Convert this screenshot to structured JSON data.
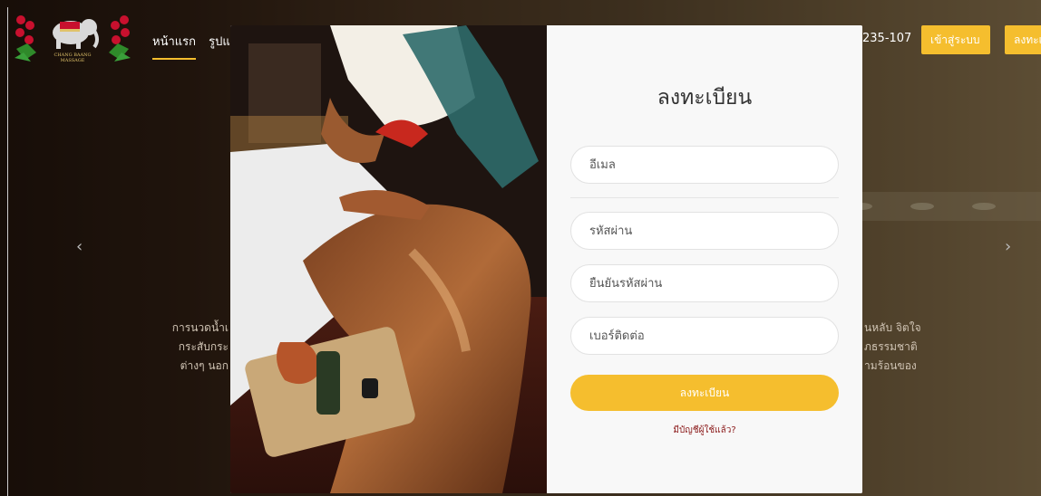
{
  "site": {
    "brand": "CHANG BAANG MASSAGE",
    "nav_items": [
      "หน้าแรก",
      "รูปแ"
    ],
    "phone": "235-107",
    "login_label": "เข้าสู่ระบบ",
    "register_label": "ลงทะเ",
    "prev_icon": "‹",
    "next_icon": "›",
    "hero_left": [
      "การนวดน้ำเ",
      "กระสับกระ",
      "ต่างๆ นอก"
    ],
    "hero_right": [
      "นหลับ จิตใจ",
      "ภธรรมชาติ",
      "ามร้อนของ"
    ]
  },
  "modal": {
    "title": "ลงทะเบียน",
    "fields": {
      "email": "อีเมล",
      "password": "รหัสผ่าน",
      "confirm_password": "ยืนยันรหัสผ่าน",
      "phone": "เบอร์ติดต่อ"
    },
    "submit_label": "ลงทะเบียน",
    "have_account": "มีบัญชีผู้ใช้แล้ว?"
  },
  "colors": {
    "accent": "#f5be2e",
    "link": "#8b1a1a"
  }
}
